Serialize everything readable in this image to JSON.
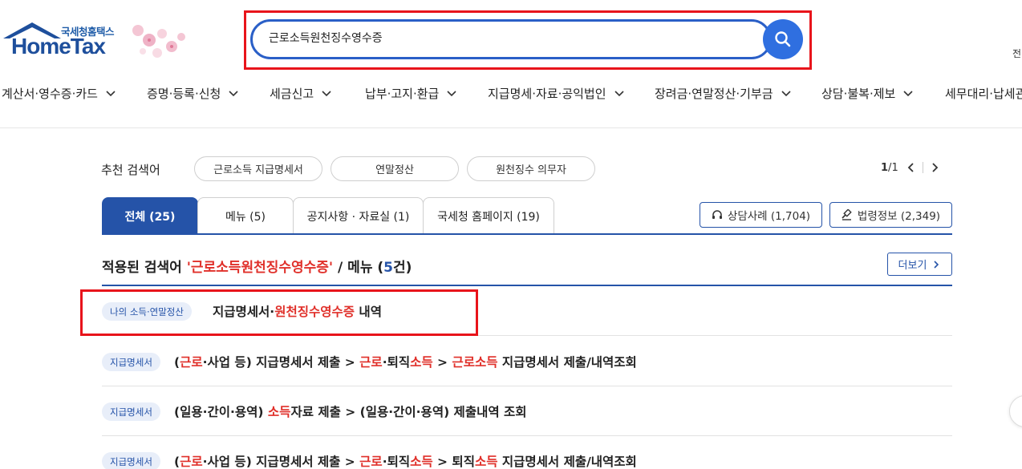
{
  "logo": {
    "sub": "국세청홈택스",
    "main": "HomeTax"
  },
  "search": {
    "value": "근로소득원천징수영수증",
    "placeholder": ""
  },
  "top_right": "전",
  "nav": [
    "계산서·영수증·카드",
    "증명·등록·신청",
    "세금신고",
    "납부·고지·환급",
    "지급명세·자료·공익법인",
    "장려금·연말정산·기부금",
    "상담·불복·제보",
    "세무대리·납세관"
  ],
  "recommended": {
    "label": "추천 검색어",
    "chips": [
      "근로소득 지급명세서",
      "연말정산",
      "원천징수 의무자"
    ],
    "page_current": "1",
    "page_sep": " / ",
    "page_total": "1"
  },
  "tabs": [
    "전체 (25)",
    "메뉴 (5)",
    "공지사항 · 자료실 (1)",
    "국세청 홈페이지 (19)"
  ],
  "side_buttons": {
    "consult": "상담사례 (1,704)",
    "law": "법령정보 (2,349)"
  },
  "result_heading": {
    "prefix": "적용된 검색어 ",
    "keyword": "'근로소득원천징수영수증'",
    "middle": " / 메뉴 (",
    "count": "5",
    "suffix": "건)",
    "more": "더보기"
  },
  "rows": [
    {
      "badge": "나의 소득·연말정산",
      "parts": [
        "지급명세서·",
        "원천징수영수증",
        " 내역"
      ]
    },
    {
      "badge": "지급명세서",
      "parts": [
        "(",
        "근로",
        "·사업 등) 지급명세서 제출 > ",
        "근로",
        "·퇴직",
        "소득",
        " > ",
        "근로소득",
        " 지급명세서 제출/내역조회"
      ]
    },
    {
      "badge": "지급명세서",
      "parts": [
        "(일용·간이·용역) ",
        "소득",
        "자료 제출 > (일용·간이·용역) 제출내역 조회"
      ]
    },
    {
      "badge": "지급명세서",
      "parts": [
        "(",
        "근로",
        "·사업 등) 지급명세서 제출 > ",
        "근로",
        "·퇴직",
        "소득",
        " > 퇴직",
        "소득",
        " 지급명세서 제출/내역조회"
      ]
    }
  ],
  "colors": {
    "brand_blue": "#2553a8",
    "highlight_red": "#e0302a",
    "outline_red": "#e8141b",
    "search_btn": "#2f6fe0"
  }
}
